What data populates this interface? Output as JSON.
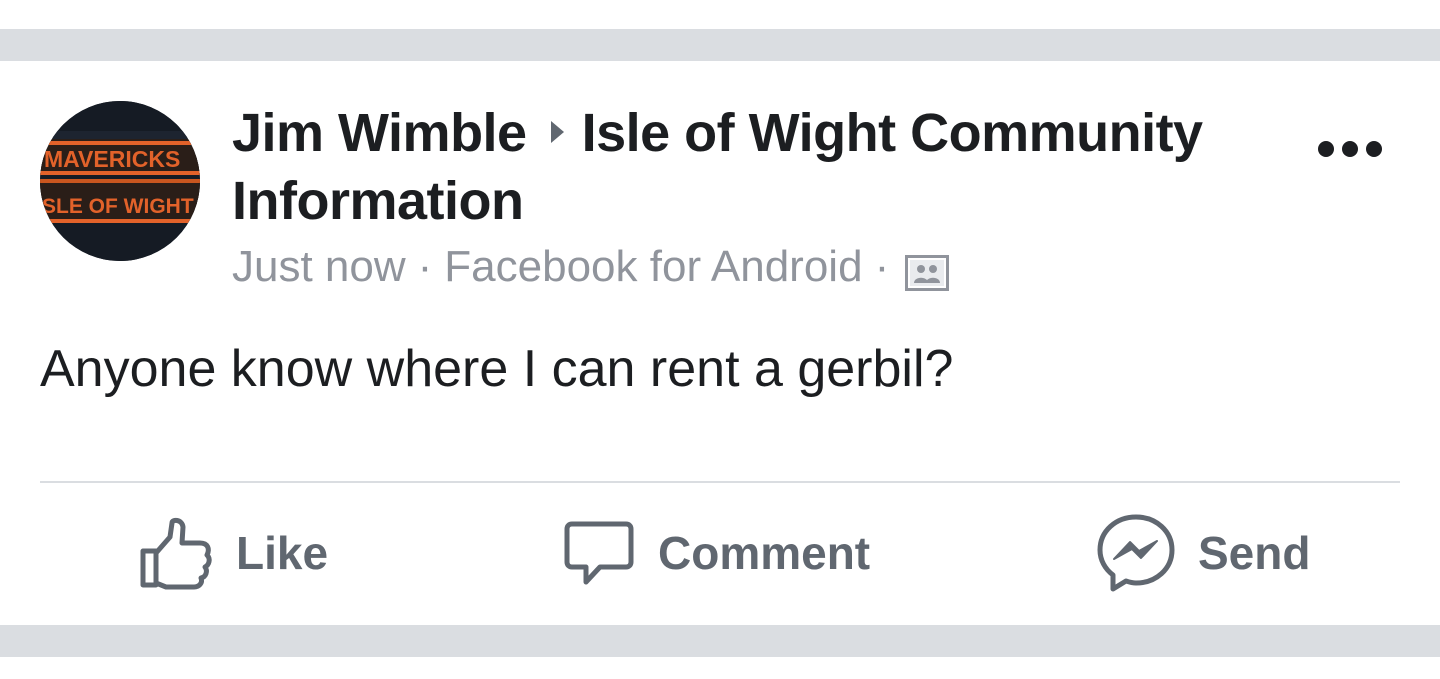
{
  "post": {
    "author": "Jim Wimble",
    "group": "Isle of Wight Community Information",
    "group_line1": "Isle of Wight Community",
    "group_line2": "Information",
    "timestamp": "Just now",
    "separator": "·",
    "source": "Facebook for Android",
    "audience_icon": "group-audience-icon",
    "message": "Anyone know where I can rent a gerbil?",
    "avatar": {
      "text_top": "MAVERICKS",
      "text_bottom": "SLE OF WIGHT"
    }
  },
  "actions": {
    "like_label": "Like",
    "comment_label": "Comment",
    "send_label": "Send"
  },
  "icons": {
    "like": "thumbs-up-icon",
    "comment": "speech-bubble-icon",
    "send": "messenger-icon",
    "more": "more-options-icon"
  },
  "colors": {
    "title_text": "#1c1e21",
    "meta_text": "#90949c",
    "action_text": "#606770",
    "separator_band": "#dadde1",
    "avatar_accent": "#e2622a"
  }
}
